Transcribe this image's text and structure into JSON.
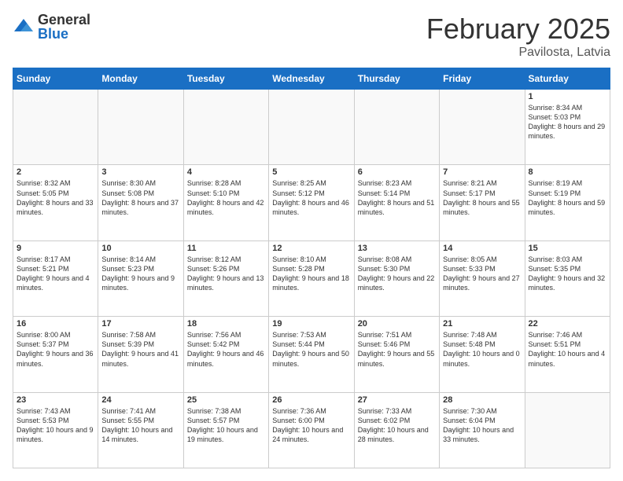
{
  "logo": {
    "general": "General",
    "blue": "Blue"
  },
  "title": "February 2025",
  "location": "Pavilosta, Latvia",
  "days_of_week": [
    "Sunday",
    "Monday",
    "Tuesday",
    "Wednesday",
    "Thursday",
    "Friday",
    "Saturday"
  ],
  "weeks": [
    [
      {
        "day": "",
        "info": ""
      },
      {
        "day": "",
        "info": ""
      },
      {
        "day": "",
        "info": ""
      },
      {
        "day": "",
        "info": ""
      },
      {
        "day": "",
        "info": ""
      },
      {
        "day": "",
        "info": ""
      },
      {
        "day": "1",
        "info": "Sunrise: 8:34 AM\nSunset: 5:03 PM\nDaylight: 8 hours and 29 minutes."
      }
    ],
    [
      {
        "day": "2",
        "info": "Sunrise: 8:32 AM\nSunset: 5:05 PM\nDaylight: 8 hours and 33 minutes."
      },
      {
        "day": "3",
        "info": "Sunrise: 8:30 AM\nSunset: 5:08 PM\nDaylight: 8 hours and 37 minutes."
      },
      {
        "day": "4",
        "info": "Sunrise: 8:28 AM\nSunset: 5:10 PM\nDaylight: 8 hours and 42 minutes."
      },
      {
        "day": "5",
        "info": "Sunrise: 8:25 AM\nSunset: 5:12 PM\nDaylight: 8 hours and 46 minutes."
      },
      {
        "day": "6",
        "info": "Sunrise: 8:23 AM\nSunset: 5:14 PM\nDaylight: 8 hours and 51 minutes."
      },
      {
        "day": "7",
        "info": "Sunrise: 8:21 AM\nSunset: 5:17 PM\nDaylight: 8 hours and 55 minutes."
      },
      {
        "day": "8",
        "info": "Sunrise: 8:19 AM\nSunset: 5:19 PM\nDaylight: 8 hours and 59 minutes."
      }
    ],
    [
      {
        "day": "9",
        "info": "Sunrise: 8:17 AM\nSunset: 5:21 PM\nDaylight: 9 hours and 4 minutes."
      },
      {
        "day": "10",
        "info": "Sunrise: 8:14 AM\nSunset: 5:23 PM\nDaylight: 9 hours and 9 minutes."
      },
      {
        "day": "11",
        "info": "Sunrise: 8:12 AM\nSunset: 5:26 PM\nDaylight: 9 hours and 13 minutes."
      },
      {
        "day": "12",
        "info": "Sunrise: 8:10 AM\nSunset: 5:28 PM\nDaylight: 9 hours and 18 minutes."
      },
      {
        "day": "13",
        "info": "Sunrise: 8:08 AM\nSunset: 5:30 PM\nDaylight: 9 hours and 22 minutes."
      },
      {
        "day": "14",
        "info": "Sunrise: 8:05 AM\nSunset: 5:33 PM\nDaylight: 9 hours and 27 minutes."
      },
      {
        "day": "15",
        "info": "Sunrise: 8:03 AM\nSunset: 5:35 PM\nDaylight: 9 hours and 32 minutes."
      }
    ],
    [
      {
        "day": "16",
        "info": "Sunrise: 8:00 AM\nSunset: 5:37 PM\nDaylight: 9 hours and 36 minutes."
      },
      {
        "day": "17",
        "info": "Sunrise: 7:58 AM\nSunset: 5:39 PM\nDaylight: 9 hours and 41 minutes."
      },
      {
        "day": "18",
        "info": "Sunrise: 7:56 AM\nSunset: 5:42 PM\nDaylight: 9 hours and 46 minutes."
      },
      {
        "day": "19",
        "info": "Sunrise: 7:53 AM\nSunset: 5:44 PM\nDaylight: 9 hours and 50 minutes."
      },
      {
        "day": "20",
        "info": "Sunrise: 7:51 AM\nSunset: 5:46 PM\nDaylight: 9 hours and 55 minutes."
      },
      {
        "day": "21",
        "info": "Sunrise: 7:48 AM\nSunset: 5:48 PM\nDaylight: 10 hours and 0 minutes."
      },
      {
        "day": "22",
        "info": "Sunrise: 7:46 AM\nSunset: 5:51 PM\nDaylight: 10 hours and 4 minutes."
      }
    ],
    [
      {
        "day": "23",
        "info": "Sunrise: 7:43 AM\nSunset: 5:53 PM\nDaylight: 10 hours and 9 minutes."
      },
      {
        "day": "24",
        "info": "Sunrise: 7:41 AM\nSunset: 5:55 PM\nDaylight: 10 hours and 14 minutes."
      },
      {
        "day": "25",
        "info": "Sunrise: 7:38 AM\nSunset: 5:57 PM\nDaylight: 10 hours and 19 minutes."
      },
      {
        "day": "26",
        "info": "Sunrise: 7:36 AM\nSunset: 6:00 PM\nDaylight: 10 hours and 24 minutes."
      },
      {
        "day": "27",
        "info": "Sunrise: 7:33 AM\nSunset: 6:02 PM\nDaylight: 10 hours and 28 minutes."
      },
      {
        "day": "28",
        "info": "Sunrise: 7:30 AM\nSunset: 6:04 PM\nDaylight: 10 hours and 33 minutes."
      },
      {
        "day": "",
        "info": ""
      }
    ]
  ]
}
